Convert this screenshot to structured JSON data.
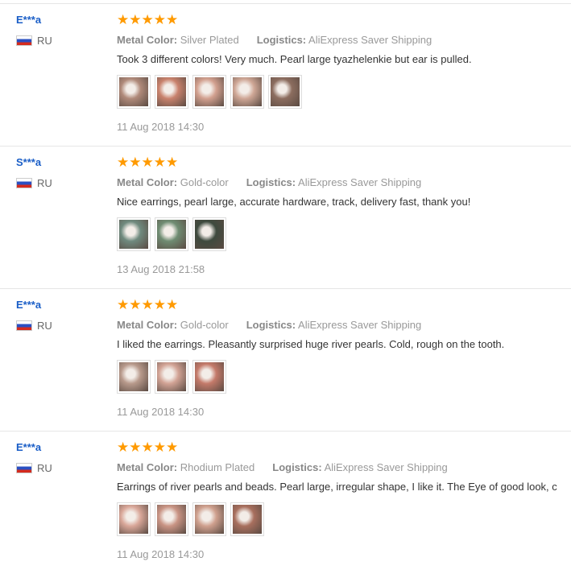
{
  "labels": {
    "metal": "Metal Color:",
    "logistics": "Logistics:"
  },
  "reviews": [
    {
      "user": "E***a",
      "country": "RU",
      "stars": "★★★★★",
      "metal": "Silver Plated",
      "logistics": "AliExpress Saver Shipping",
      "text": "Took 3 different colors! Very much. Pearl large tyazhelenkie but ear is pulled.",
      "date": "11 Aug 2018 14:30"
    },
    {
      "user": "S***a",
      "country": "RU",
      "stars": "★★★★★",
      "metal": "Gold-color",
      "logistics": "AliExpress Saver Shipping",
      "text": "Nice earrings, pearl large, accurate hardware, track, delivery fast, thank you!",
      "date": "13 Aug 2018 21:58"
    },
    {
      "user": "E***a",
      "country": "RU",
      "stars": "★★★★★",
      "metal": "Gold-color",
      "logistics": "AliExpress Saver Shipping",
      "text": "I liked the earrings. Pleasantly surprised huge river pearls. Cold, rough on the tooth.",
      "date": "11 Aug 2018 14:30"
    },
    {
      "user": "E***a",
      "country": "RU",
      "stars": "★★★★★",
      "metal": "Rhodium Plated",
      "logistics": "AliExpress Saver Shipping",
      "text": "Earrings of river pearls and beads. Pearl large, irregular shape, I like it. The Eye of good look, c",
      "date": "11 Aug 2018 14:30"
    }
  ],
  "photo_colors": {
    "r0": [
      "#b08a7a",
      "#c9826d",
      "#d2a08f",
      "#cfa796",
      "#8c6d5f"
    ],
    "r1": [
      "#6f8a7e",
      "#6f8c72",
      "#3e4a3e"
    ],
    "r2": [
      "#b89a8c",
      "#d2a395",
      "#c47a6a"
    ],
    "r3": [
      "#d9a799",
      "#c99484",
      "#cfa08e",
      "#a86f5e"
    ]
  }
}
